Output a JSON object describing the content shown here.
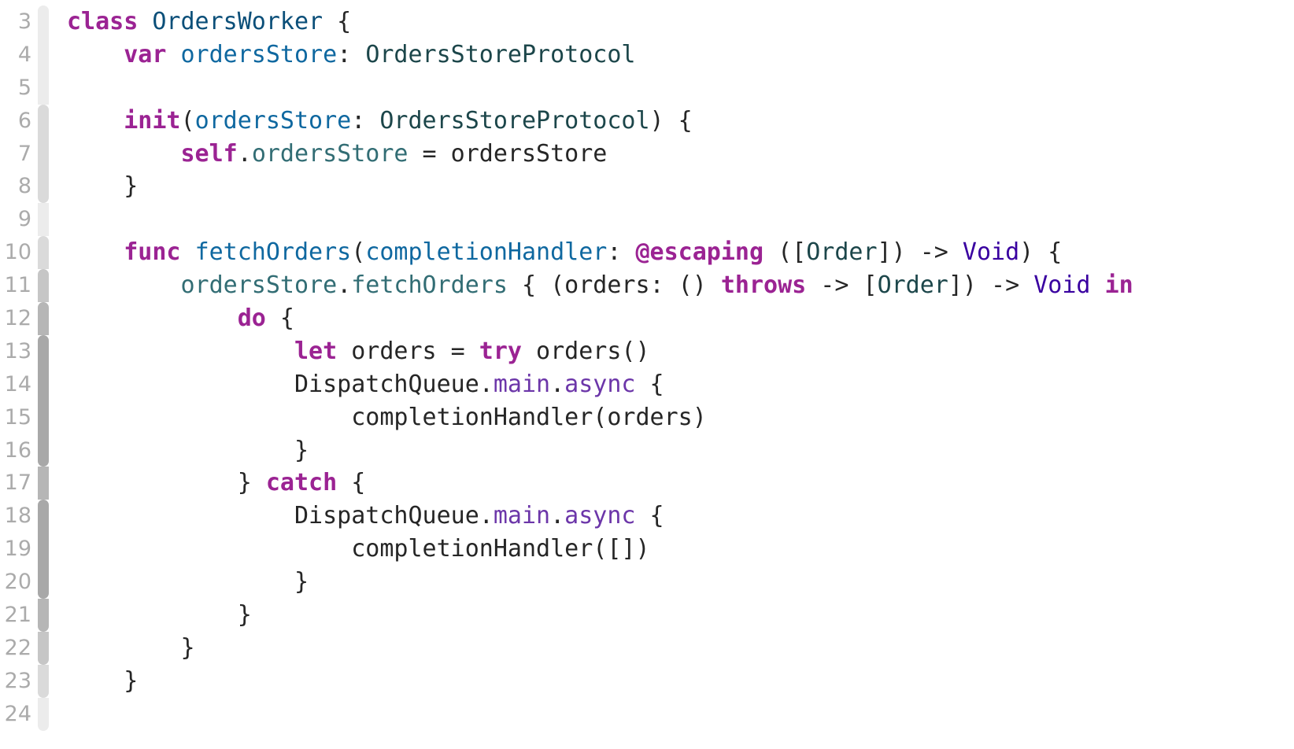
{
  "editor": {
    "colors": {
      "keyword": "#9b2393",
      "declaration": "#0f68a0",
      "type": "#0b4f79",
      "project_type": "#1c464a",
      "member": "#326d74",
      "system_type": "#3900a0",
      "system_function": "#6c36a9",
      "plain": "#262626",
      "line_number": "#ababab"
    },
    "lines": [
      {
        "n": "3",
        "tokens": [
          [
            "class",
            "kw"
          ],
          [
            " ",
            "plain"
          ],
          [
            "OrdersWorker",
            "type"
          ],
          [
            " {",
            "plain"
          ]
        ]
      },
      {
        "n": "4",
        "tokens": [
          [
            "    ",
            "plain"
          ],
          [
            "var",
            "kw"
          ],
          [
            " ",
            "plain"
          ],
          [
            "ordersStore",
            "decl"
          ],
          [
            ": ",
            "plain"
          ],
          [
            "OrdersStoreProtocol",
            "ptype"
          ]
        ]
      },
      {
        "n": "5",
        "tokens": []
      },
      {
        "n": "6",
        "tokens": [
          [
            "    ",
            "plain"
          ],
          [
            "init",
            "kw"
          ],
          [
            "(",
            "plain"
          ],
          [
            "ordersStore",
            "decl"
          ],
          [
            ": ",
            "plain"
          ],
          [
            "OrdersStoreProtocol",
            "ptype"
          ],
          [
            ") {",
            "plain"
          ]
        ]
      },
      {
        "n": "7",
        "tokens": [
          [
            "        ",
            "plain"
          ],
          [
            "self",
            "kw"
          ],
          [
            ".",
            "plain"
          ],
          [
            "ordersStore",
            "member"
          ],
          [
            " = ordersStore",
            "plain"
          ]
        ]
      },
      {
        "n": "8",
        "tokens": [
          [
            "    }",
            "plain"
          ]
        ]
      },
      {
        "n": "9",
        "tokens": []
      },
      {
        "n": "10",
        "tokens": [
          [
            "    ",
            "plain"
          ],
          [
            "func",
            "kw"
          ],
          [
            " ",
            "plain"
          ],
          [
            "fetchOrders",
            "decl"
          ],
          [
            "(",
            "plain"
          ],
          [
            "completionHandler",
            "decl"
          ],
          [
            ": ",
            "plain"
          ],
          [
            "@escaping",
            "kw"
          ],
          [
            " ([",
            "plain"
          ],
          [
            "Order",
            "ptype"
          ],
          [
            "]) -> ",
            "plain"
          ],
          [
            "Void",
            "stype"
          ],
          [
            ") {",
            "plain"
          ]
        ]
      },
      {
        "n": "11",
        "tokens": [
          [
            "        ",
            "plain"
          ],
          [
            "ordersStore",
            "member"
          ],
          [
            ".",
            "plain"
          ],
          [
            "fetchOrders",
            "member"
          ],
          [
            " { (orders: () ",
            "plain"
          ],
          [
            "throws",
            "kw"
          ],
          [
            " -> [",
            "plain"
          ],
          [
            "Order",
            "ptype"
          ],
          [
            "]) -> ",
            "plain"
          ],
          [
            "Void",
            "stype"
          ],
          [
            " ",
            "plain"
          ],
          [
            "in",
            "kw"
          ]
        ]
      },
      {
        "n": "12",
        "tokens": [
          [
            "            ",
            "plain"
          ],
          [
            "do",
            "kw"
          ],
          [
            " {",
            "plain"
          ]
        ]
      },
      {
        "n": "13",
        "tokens": [
          [
            "                ",
            "plain"
          ],
          [
            "let",
            "kw"
          ],
          [
            " orders = ",
            "plain"
          ],
          [
            "try",
            "kw"
          ],
          [
            " orders()",
            "plain"
          ]
        ]
      },
      {
        "n": "14",
        "tokens": [
          [
            "                DispatchQueue.",
            "plain"
          ],
          [
            "main",
            "sfunc"
          ],
          [
            ".",
            "plain"
          ],
          [
            "async",
            "sfunc"
          ],
          [
            " {",
            "plain"
          ]
        ]
      },
      {
        "n": "15",
        "tokens": [
          [
            "                    completionHandler(orders)",
            "plain"
          ]
        ]
      },
      {
        "n": "16",
        "tokens": [
          [
            "                }",
            "plain"
          ]
        ]
      },
      {
        "n": "17",
        "tokens": [
          [
            "            } ",
            "plain"
          ],
          [
            "catch",
            "kw"
          ],
          [
            " {",
            "plain"
          ]
        ]
      },
      {
        "n": "18",
        "tokens": [
          [
            "                DispatchQueue.",
            "plain"
          ],
          [
            "main",
            "sfunc"
          ],
          [
            ".",
            "plain"
          ],
          [
            "async",
            "sfunc"
          ],
          [
            " {",
            "plain"
          ]
        ]
      },
      {
        "n": "19",
        "tokens": [
          [
            "                    completionHandler([])",
            "plain"
          ]
        ]
      },
      {
        "n": "20",
        "tokens": [
          [
            "                }",
            "plain"
          ]
        ]
      },
      {
        "n": "21",
        "tokens": [
          [
            "            }",
            "plain"
          ]
        ]
      },
      {
        "n": "22",
        "tokens": [
          [
            "        }",
            "plain"
          ]
        ]
      },
      {
        "n": "23",
        "tokens": [
          [
            "    }",
            "plain"
          ]
        ]
      },
      {
        "n": "24",
        "tokens": []
      }
    ]
  }
}
